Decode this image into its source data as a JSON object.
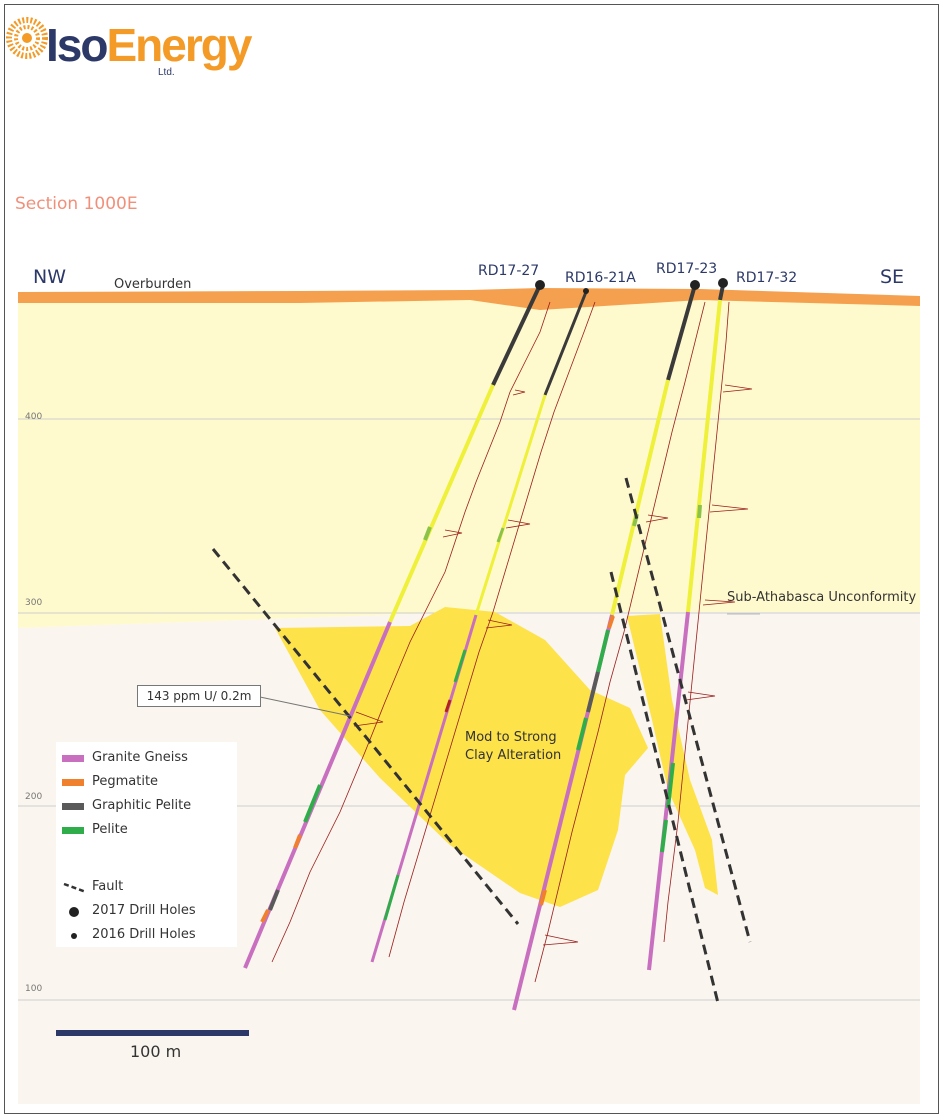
{
  "logo": {
    "text_iso": "Iso",
    "text_energy": "Energy",
    "text_ltd": "Ltd."
  },
  "section_title": "Section 1000E",
  "directions": {
    "left": "NW",
    "right": "SE"
  },
  "overburden_label": "Overburden",
  "unconformity_label": "Sub-Athabasca Unconformity",
  "alteration_label_line1": "Mod to Strong",
  "alteration_label_line2": "Clay Alteration",
  "callout": "143 ppm U/ 0.2m",
  "elevations": [
    "400",
    "300",
    "200",
    "100"
  ],
  "drill_holes": [
    {
      "name": "RD17-27",
      "year": "2017"
    },
    {
      "name": "RD16-21A",
      "year": "2016"
    },
    {
      "name": "RD17-23",
      "year": "2017"
    },
    {
      "name": "RD17-32",
      "year": "2017"
    }
  ],
  "legend": {
    "items": [
      {
        "label": "Granite Gneiss",
        "color": "#c86fc0"
      },
      {
        "label": "Pegmatite",
        "color": "#f07f2e"
      },
      {
        "label": "Graphitic Pelite",
        "color": "#5a5a5a"
      },
      {
        "label": "Pelite",
        "color": "#2fad4a"
      }
    ],
    "fault": "Fault",
    "holes_2017": "2017 Drill Holes",
    "holes_2016": "2016 Drill Holes"
  },
  "scale_bar": "100 m",
  "colors": {
    "sandstone": "#fffacd",
    "basement": "#faf5ee",
    "overburden": "#f5a04e",
    "alteration": "#fde24a",
    "sandstone_core": "#eef03a",
    "upper_core": "#3a3a3a",
    "gamma_trace": "#9b1c1c",
    "navy": "#2c3968"
  }
}
